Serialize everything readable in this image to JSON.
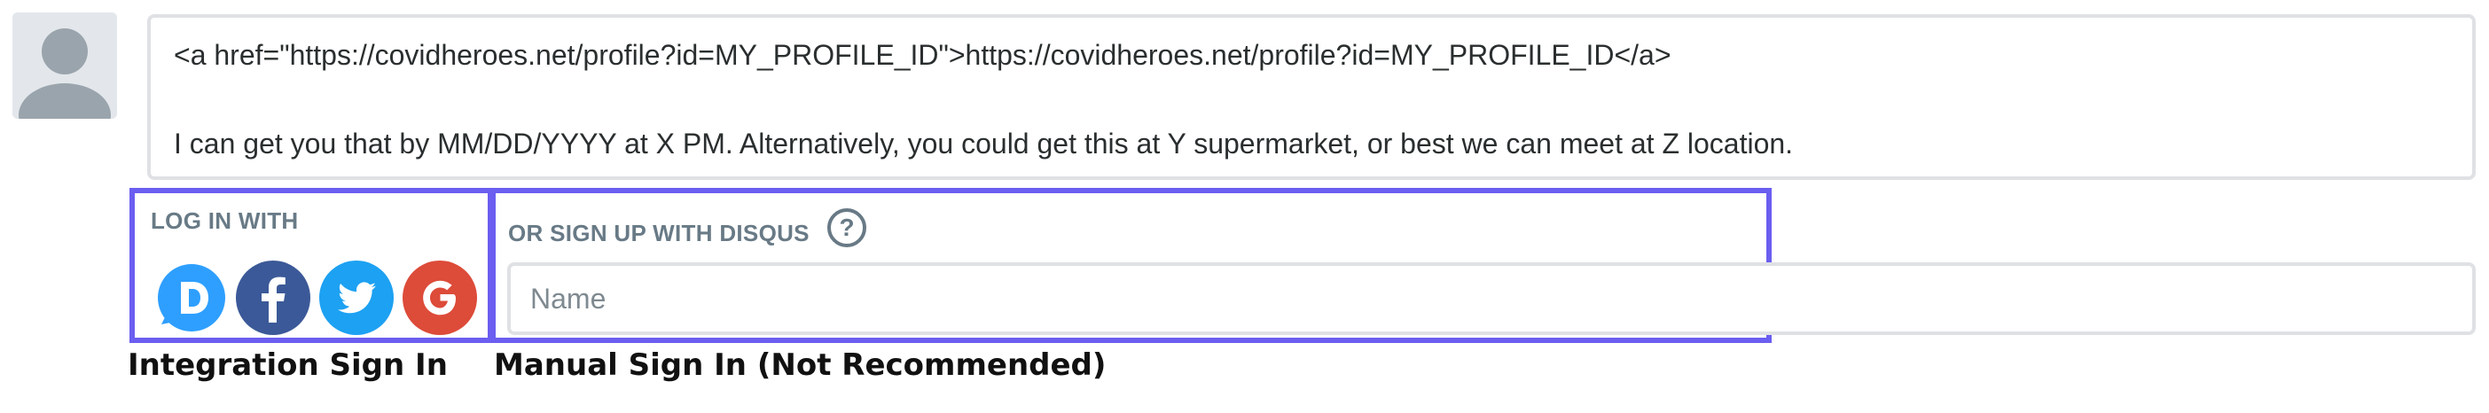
{
  "avatar": {
    "icon": "user-avatar-placeholder-icon"
  },
  "comment": {
    "line1": "<a href=\"https://covidheroes.net/profile?id=MY_PROFILE_ID\">https://covidheroes.net/profile?id=MY_PROFILE_ID</a>",
    "line2": "I can get you that by MM/DD/YYYY at X PM. Alternatively, you could get this at Y supermarket, or best we can meet at Z location."
  },
  "login": {
    "title": "LOG IN WITH",
    "providers": [
      {
        "name": "Disqus",
        "icon": "disqus-icon",
        "color": "#2e9fff"
      },
      {
        "name": "Facebook",
        "icon": "facebook-icon",
        "color": "#3b5998"
      },
      {
        "name": "Twitter",
        "icon": "twitter-icon",
        "color": "#1da1f2"
      },
      {
        "name": "Google",
        "icon": "google-icon",
        "color": "#dd4b39"
      }
    ]
  },
  "signup": {
    "title": "OR SIGN UP WITH DISQUS",
    "help_icon": "question-mark-icon",
    "name_placeholder": "Name"
  },
  "annotations": {
    "integration_caption": "Integration Sign In",
    "manual_caption": "Manual Sign In (Not Recommended)",
    "highlight_color": "#6b5ef0"
  }
}
